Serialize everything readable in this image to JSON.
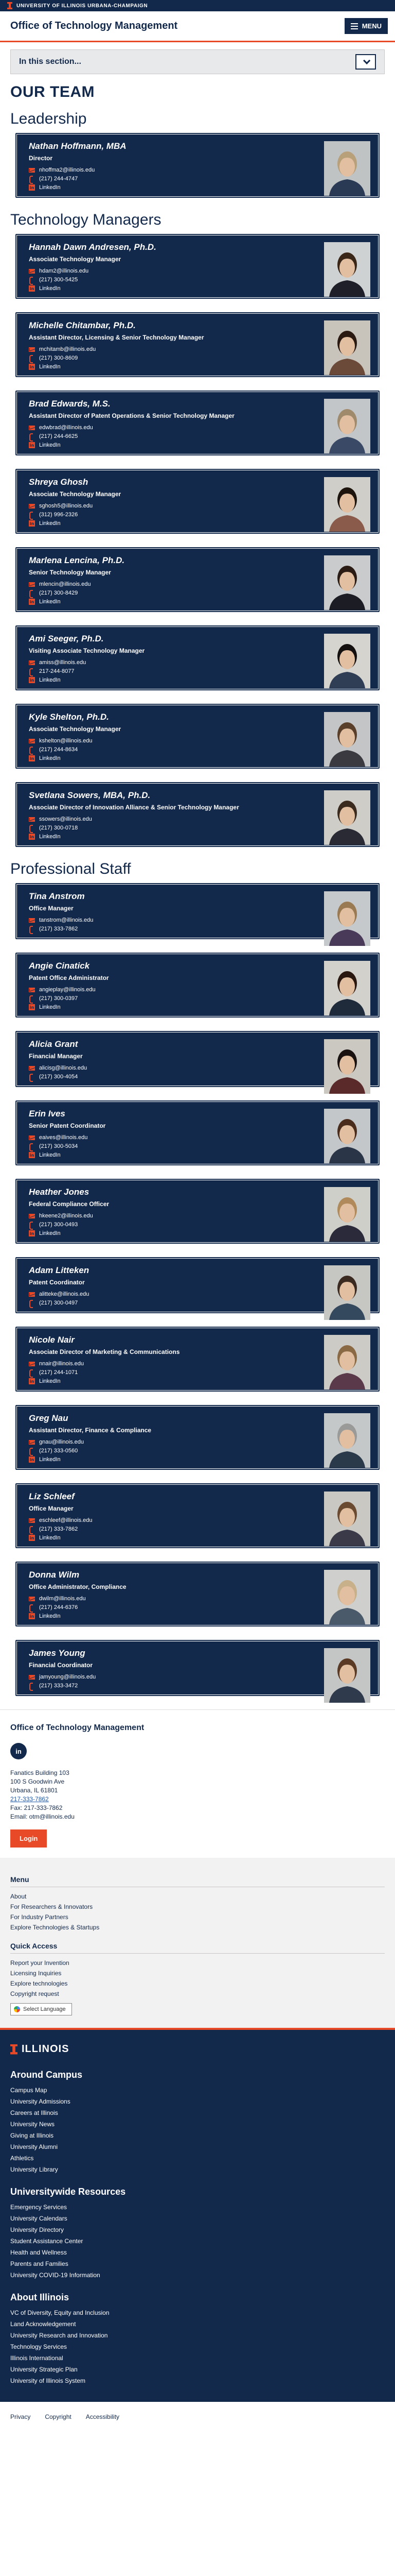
{
  "brand": {
    "text": "UNIVERSITY OF ILLINOIS URBANA-CHAMPAIGN"
  },
  "header": {
    "site_title": "Office of Technology Management",
    "menu_label": "MENU"
  },
  "section_nav": {
    "label": "In this section..."
  },
  "page_title": "OUR TEAM",
  "groups": [
    {
      "heading": "Leadership",
      "members": [
        {
          "name": "Nathan Hoffmann, MBA",
          "title": "Director",
          "email": "nhoffma2@illinois.edu",
          "phone": "(217) 244-4747",
          "linkedin": "LinkedIn",
          "photo": {
            "hair": "#b8a07a",
            "shirt": "#2a3a55",
            "bg": "#bfc3c4"
          }
        }
      ]
    },
    {
      "heading": "Technology Managers",
      "members": [
        {
          "name": "Hannah Dawn Andresen, Ph.D.",
          "title": "Associate Technology Manager",
          "email": "hdam2@illinois.edu",
          "phone": "(217) 300-5425",
          "linkedin": "LinkedIn",
          "photo": {
            "hair": "#3a2718",
            "shirt": "#1f1f2a",
            "bg": "#cfd2d3"
          }
        },
        {
          "name": "Michelle Chitambar, Ph.D.",
          "title": "Assistant Director, Licensing & Senior Technology Manager",
          "email": "mchitamb@illinois.edu",
          "phone": "(217) 300-8609",
          "linkedin": "LinkedIn",
          "photo": {
            "hair": "#2b1a12",
            "shirt": "#6b4a3a",
            "bg": "#c8c4bc"
          }
        },
        {
          "name": "Brad Edwards, M.S.",
          "title": "Assistant Director of Patent Operations & Senior Technology Manager",
          "email": "edwbrad@illinois.edu",
          "phone": "(217) 244-6625",
          "linkedin": "LinkedIn",
          "photo": {
            "hair": "#a08a6c",
            "shirt": "#3a4a66",
            "bg": "#c2c6c9"
          }
        },
        {
          "name": "Shreya Ghosh",
          "title": "Associate Technology Manager",
          "email": "sghosh5@illinois.edu",
          "phone": "(312) 996-2326",
          "linkedin": "LinkedIn",
          "photo": {
            "hair": "#1e140e",
            "shirt": "#8a5a4a",
            "bg": "#d0cec8"
          }
        },
        {
          "name": "Marlena Lencina, Ph.D.",
          "title": "Senior Technology Manager",
          "email": "mlencin@illinois.edu",
          "phone": "(217) 300-8429",
          "linkedin": "LinkedIn",
          "photo": {
            "hair": "#2a1c14",
            "shirt": "#1c1c24",
            "bg": "#c9cbcc"
          }
        },
        {
          "name": "Ami Seeger, Ph.D.",
          "title": "Visiting Associate Technology Manager",
          "email": "amiss@illinois.edu",
          "phone": "217-244-8077",
          "linkedin": "LinkedIn",
          "photo": {
            "hair": "#151010",
            "shirt": "#2f3e55",
            "bg": "#d6d4cf"
          }
        },
        {
          "name": "Kyle Shelton, Ph.D.",
          "title": "Associate Technology Manager",
          "email": "kshelton@illinois.edu",
          "phone": "(217) 244-8634",
          "linkedin": "LinkedIn",
          "photo": {
            "hair": "#5a3f2a",
            "shirt": "#3a3a40",
            "bg": "#c3c5c6"
          }
        },
        {
          "name": "Svetlana Sowers, MBA, Ph.D.",
          "title": "Associate Director of Innovation Alliance & Senior Technology Manager",
          "email": "ssowers@illinois.edu",
          "phone": "(217) 300-0718",
          "linkedin": "LinkedIn",
          "photo": {
            "hair": "#3b2a1e",
            "shirt": "#2a2a34",
            "bg": "#cfcdc8"
          }
        }
      ]
    },
    {
      "heading": "Professional Staff",
      "members": [
        {
          "name": "Tina Anstrom",
          "title": "Office Manager",
          "email": "tanstrom@illinois.edu",
          "phone": "(217) 333-7862",
          "linkedin": "",
          "photo": {
            "hair": "#9a7a52",
            "shirt": "#4a3a5a",
            "bg": "#c6c9cb"
          }
        },
        {
          "name": "Angie Cinatick",
          "title": "Patent Office Administrator",
          "email": "angieplay@illinois.edu",
          "phone": "(217) 300-0397",
          "linkedin": "LinkedIn",
          "photo": {
            "hair": "#2a1810",
            "shirt": "#1f2a3a",
            "bg": "#d3d1cb"
          }
        },
        {
          "name": "Alicia Grant",
          "title": "Financial Manager",
          "email": "alicisg@illinois.edu",
          "phone": "(217) 300-4054",
          "linkedin": "",
          "photo": {
            "hair": "#1a1210",
            "shirt": "#5a2a2a",
            "bg": "#cbc8c2"
          }
        },
        {
          "name": "Erin Ives",
          "title": "Senior Patent Coordinator",
          "email": "eaives@illinois.edu",
          "phone": "(217) 300-5034",
          "linkedin": "LinkedIn",
          "photo": {
            "hair": "#4a2c1c",
            "shirt": "#2a3648",
            "bg": "#c4c7c9"
          }
        },
        {
          "name": "Heather Jones",
          "title": "Federal Compliance Officer",
          "email": "hkeene2@illinois.edu",
          "phone": "(217) 300-0493",
          "linkedin": "LinkedIn",
          "photo": {
            "hair": "#b08a5a",
            "shirt": "#2a2a3a",
            "bg": "#cfcfca"
          }
        },
        {
          "name": "Adam Litteken",
          "title": "Patent Coordinator",
          "email": "alitteke@illinois.edu",
          "phone": "(217) 300-0497",
          "linkedin": "",
          "photo": {
            "hair": "#3a2a20",
            "shirt": "#34495e",
            "bg": "#c6c6c2"
          }
        },
        {
          "name": "Nicole Nair",
          "title": "Associate Director of Marketing & Communications",
          "email": "nnair@illinois.edu",
          "phone": "(217) 244-1071",
          "linkedin": "LinkedIn",
          "photo": {
            "hair": "#8a6a44",
            "shirt": "#5a3a4a",
            "bg": "#cdcbc6"
          }
        },
        {
          "name": "Greg Nau",
          "title": "Assistant Director, Finance & Compliance",
          "email": "gnau@illinois.edu",
          "phone": "(217) 333-0560",
          "linkedin": "LinkedIn",
          "photo": {
            "hair": "#9a9a98",
            "shirt": "#2a3a4a",
            "bg": "#c5c8c9"
          }
        },
        {
          "name": "Liz Schleef",
          "title": "Office Manager",
          "email": "eschleef@illinois.edu",
          "phone": "(217) 333-7862",
          "linkedin": "LinkedIn",
          "photo": {
            "hair": "#6a4a30",
            "shirt": "#3a3a48",
            "bg": "#cac8c3"
          }
        },
        {
          "name": "Donna Wilm",
          "title": "Office Administrator, Compliance",
          "email": "dwilm@illinois.edu",
          "phone": "(217) 244-6376",
          "linkedin": "LinkedIn",
          "photo": {
            "hair": "#c8b08a",
            "shirt": "#4a5a6a",
            "bg": "#cfd0cd"
          }
        },
        {
          "name": "James Young",
          "title": "Financial Coordinator",
          "email": "jamyoung@illinois.edu",
          "phone": "(217) 333-3472",
          "linkedin": "",
          "photo": {
            "hair": "#5a3a24",
            "shirt": "#2f3b4d",
            "bg": "#c4c6c6"
          }
        }
      ]
    }
  ],
  "footer_office": {
    "title": "Office of Technology Management",
    "linkedin_label": "in",
    "address": [
      "Fanatics Building 103",
      "100 S Goodwin Ave",
      "Urbana, IL 61801"
    ],
    "phone": "217-333-7862",
    "fax": "Fax: 217-333-7862",
    "email": "Email: otm@illinois.edu",
    "login_label": "Login"
  },
  "footer_menu": {
    "menu_heading": "Menu",
    "menu_links": [
      "About",
      "For Researchers & Innovators",
      "For Industry Partners",
      "Explore Technologies & Startups"
    ],
    "quick_heading": "Quick Access",
    "quick_links": [
      "Report your Invention",
      "Licensing Inquiries",
      "Explore technologies",
      "Copyright request"
    ],
    "language_label": "Select Language"
  },
  "campus": {
    "logo_text": "ILLINOIS",
    "sections": [
      {
        "heading": "Around Campus",
        "links": [
          "Campus Map",
          "University Admissions",
          "Careers at Illinois",
          "University News",
          "Giving at Illinois",
          "University Alumni",
          "Athletics",
          "University Library"
        ]
      },
      {
        "heading": "Universitywide Resources",
        "links": [
          "Emergency Services",
          "University Calendars",
          "University Directory",
          "Student Assistance Center",
          "Health and Wellness",
          "Parents and Families",
          "University COVID-19 Information"
        ]
      },
      {
        "heading": "About Illinois",
        "links": [
          "VC of Diversity, Equity and Inclusion",
          "Land Acknowledgement",
          "University Research and Innovation",
          "Technology Services",
          "Illinois International",
          "University Strategic Plan",
          "University of Illinois System"
        ]
      }
    ]
  },
  "legal": {
    "links": [
      "Privacy",
      "Copyright",
      "Accessibility"
    ]
  }
}
